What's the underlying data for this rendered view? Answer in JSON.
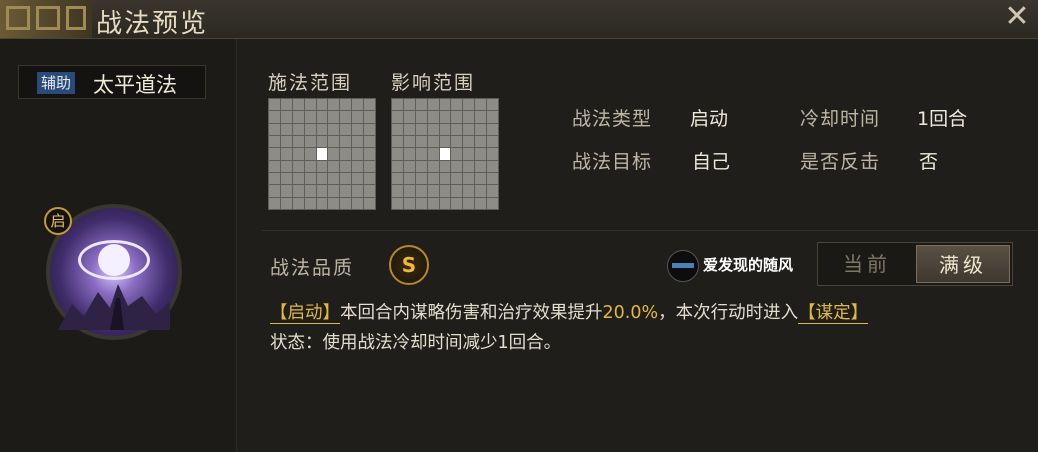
{
  "window": {
    "title": "战法预览",
    "close_glyph": "✕"
  },
  "skill": {
    "role_tag": "辅助",
    "name": "太平道法",
    "icon_badge": "启"
  },
  "ranges": {
    "cast_label": "施法范围",
    "effect_label": "影响范围"
  },
  "info": {
    "type_label": "战法类型",
    "type_value": "启动",
    "cooldown_label": "冷却时间",
    "cooldown_value": "1回合",
    "target_label": "战法目标",
    "target_value": "自己",
    "counter_label": "是否反击",
    "counter_value": "否"
  },
  "quality": {
    "label": "战法品质",
    "grade": "S"
  },
  "watermark": {
    "text": "爱发现的随风"
  },
  "level_toggle": {
    "current": "当前",
    "max": "满级",
    "selected": "满级"
  },
  "description": {
    "tag_open": "【启动】",
    "part1": "本回合内谋略伤害和治疗效果提升",
    "value": "20.0%",
    "part2": "，本次行动时进入",
    "state_tag": "【谋定】",
    "line2": "状态：使用战法冷却时间减少1回合。"
  },
  "colors": {
    "accent_gold": "#e0b84a",
    "role_tag_bg": "#2a4a78"
  }
}
